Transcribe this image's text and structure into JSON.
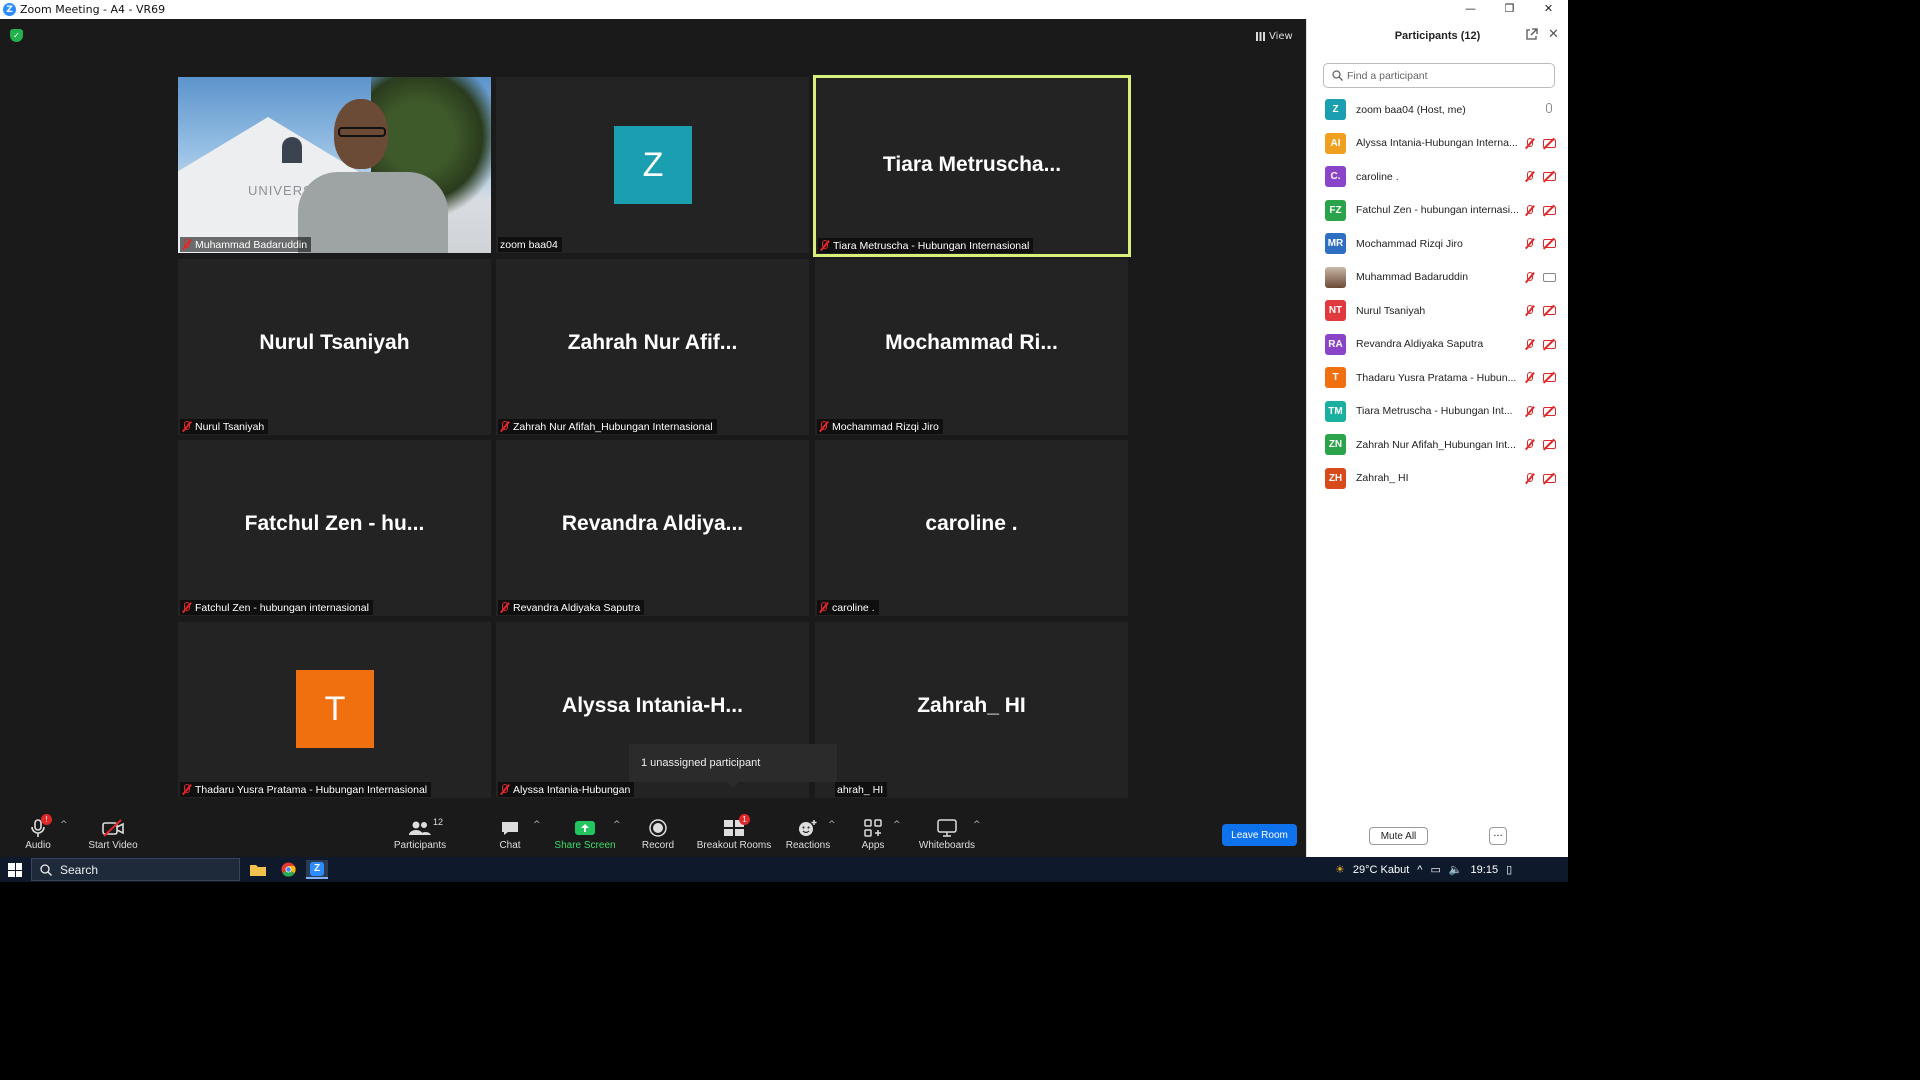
{
  "window": {
    "title": "Zoom Meeting - A4 - VR69",
    "controls": [
      "—",
      "❐",
      "✕"
    ]
  },
  "meeting": {
    "view_label": "View",
    "tiles": [
      {
        "center": "",
        "label": "Muhammad Badaruddin",
        "video": true,
        "muted": true
      },
      {
        "center": "",
        "label": "zoom baa04",
        "avatar": "Z",
        "avatar_color": "#1a9fb0",
        "muted": false
      },
      {
        "center": "Tiara  Metruscha...",
        "label": "Tiara Metruscha - Hubungan Internasional",
        "muted": true,
        "active": true
      },
      {
        "center": "Nurul Tsaniyah",
        "label": "Nurul Tsaniyah",
        "muted": true
      },
      {
        "center": "Zahrah Nur Afif...",
        "label": "Zahrah Nur Afifah_Hubungan Internasional",
        "muted": true
      },
      {
        "center": "Mochammad  Ri...",
        "label": "Mochammad Rizqi Jiro",
        "muted": true
      },
      {
        "center": "Fatchul Zen - hu...",
        "label": "Fatchul Zen - hubungan internasional",
        "muted": true
      },
      {
        "center": "Revandra  Aldiya...",
        "label": "Revandra Aldiyaka Saputra",
        "muted": true
      },
      {
        "center": "caroline .",
        "label": "caroline .",
        "muted": true
      },
      {
        "center": "",
        "label": "Thadaru Yusra Pratama - Hubungan Internasional",
        "avatar": "T",
        "avatar_color": "#f07010",
        "muted": true
      },
      {
        "center": "Alyssa  Intania-H...",
        "label": "Alyssa Intania-Hubungan",
        "muted": true
      },
      {
        "center": "Zahrah_ HI",
        "label": "ahrah_ HI",
        "muted": true
      }
    ],
    "video_sign": "UNIVERSITAS",
    "tooltip": "1 unassigned participant"
  },
  "toolbar": {
    "audio": "Audio",
    "audio_badge": "!",
    "start_video": "Start Video",
    "participants": "Participants",
    "participants_count": "12",
    "chat": "Chat",
    "share_screen": "Share Screen",
    "record": "Record",
    "breakout_rooms": "Breakout Rooms",
    "breakout_badge": "1",
    "reactions": "Reactions",
    "apps": "Apps",
    "whiteboards": "Whiteboards",
    "leave": "Leave Room"
  },
  "panel": {
    "title": "Participants (12)",
    "search_placeholder": "Find a participant",
    "participants": [
      {
        "initials": "Z",
        "color": "#1a9fb0",
        "name": "zoom baa04 (Host, me)",
        "host": true
      },
      {
        "initials": "AI",
        "color": "#f0a020",
        "name": "Alyssa Intania-Hubungan Interna..."
      },
      {
        "initials": "C.",
        "color": "#8a44c8",
        "name": "caroline ."
      },
      {
        "initials": "FZ",
        "color": "#2aa34a",
        "name": "Fatchul Zen - hubungan internasi..."
      },
      {
        "initials": "MR",
        "color": "#2f6fc2",
        "name": "Mochammad Rizqi Jiro"
      },
      {
        "initials": "",
        "color": "#8d6a4e",
        "name": "Muhammad Badaruddin",
        "photo": true,
        "cam_on": true
      },
      {
        "initials": "NT",
        "color": "#e0393e",
        "name": "Nurul Tsaniyah"
      },
      {
        "initials": "RA",
        "color": "#8a44c8",
        "name": "Revandra Aldiyaka Saputra"
      },
      {
        "initials": "T",
        "color": "#f07010",
        "name": "Thadaru Yusra Pratama - Hubun..."
      },
      {
        "initials": "TM",
        "color": "#1ab0a0",
        "name": "Tiara Metruscha - Hubungan Int..."
      },
      {
        "initials": "ZN",
        "color": "#2aa34a",
        "name": "Zahrah Nur Afifah_Hubungan Int..."
      },
      {
        "initials": "ZH",
        "color": "#d84a1a",
        "name": "Zahrah_ HI"
      }
    ],
    "mute_all": "Mute All",
    "more": "···"
  },
  "taskbar": {
    "search": "Search",
    "weather": "29°C  Kabut",
    "time": "19:15"
  }
}
